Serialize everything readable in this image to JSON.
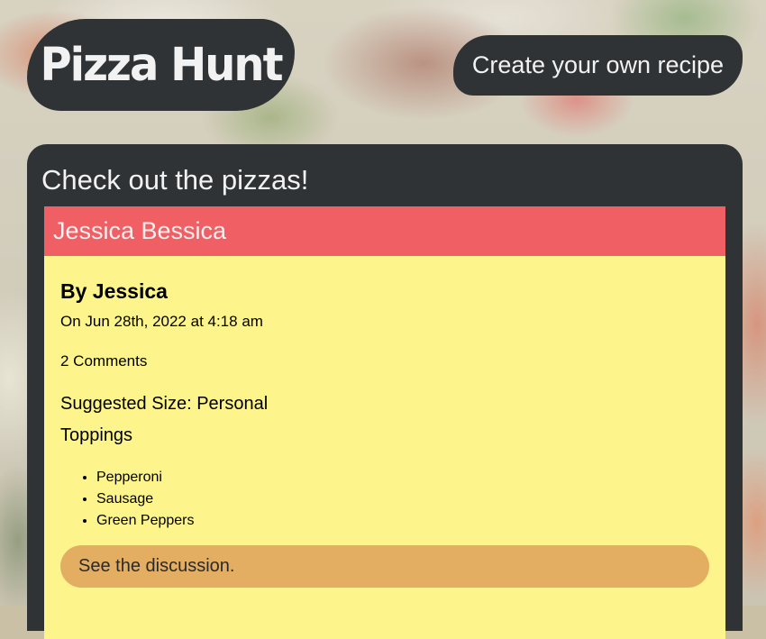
{
  "header": {
    "logo_text": "Pizza Hunt",
    "create_label": "Create your own recipe"
  },
  "main": {
    "title": "Check out the pizzas!",
    "pizza": {
      "name": "Jessica Bessica",
      "author": "By Jessica",
      "date": "On Jun 28th, 2022 at 4:18 am",
      "comments": "2 Comments",
      "size": "Suggested Size: Personal",
      "toppings_label": "Toppings",
      "toppings": [
        "Pepperoni",
        "Sausage",
        "Green Peppers"
      ],
      "discussion_label": "See the discussion."
    }
  },
  "colors": {
    "dark": "#2f3336",
    "card_bg": "#fdf58b",
    "card_header": "#ef5f63",
    "button": "#e3ae62"
  }
}
